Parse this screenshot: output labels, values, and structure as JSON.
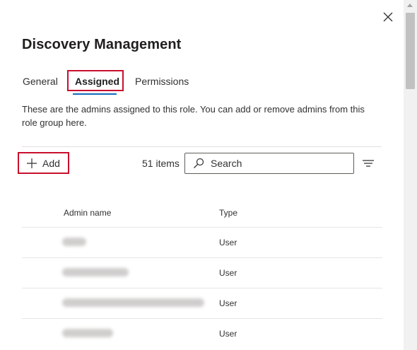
{
  "panel": {
    "title": "Discovery Management",
    "close_icon": "close-icon"
  },
  "tabs": [
    {
      "label": "General",
      "selected": false
    },
    {
      "label": "Assigned",
      "selected": true
    },
    {
      "label": "Permissions",
      "selected": false
    }
  ],
  "description": "These are the admins assigned to this role. You can add or remove admins from this role group here.",
  "toolbar": {
    "add_label": "Add",
    "add_icon": "plus-icon",
    "item_count": "51 items",
    "search_placeholder": "Search",
    "search_icon": "search-icon",
    "filter_icon": "filter-icon"
  },
  "table": {
    "columns": [
      "Admin name",
      "Type"
    ],
    "rows": [
      {
        "admin_name": "",
        "type": "User"
      },
      {
        "admin_name": "",
        "type": "User"
      },
      {
        "admin_name": "",
        "type": "User"
      },
      {
        "admin_name": "",
        "type": "User"
      }
    ]
  },
  "colors": {
    "highlight_box": "#c8102e",
    "tab_underline": "#0f6cbd",
    "text": "#323130"
  }
}
